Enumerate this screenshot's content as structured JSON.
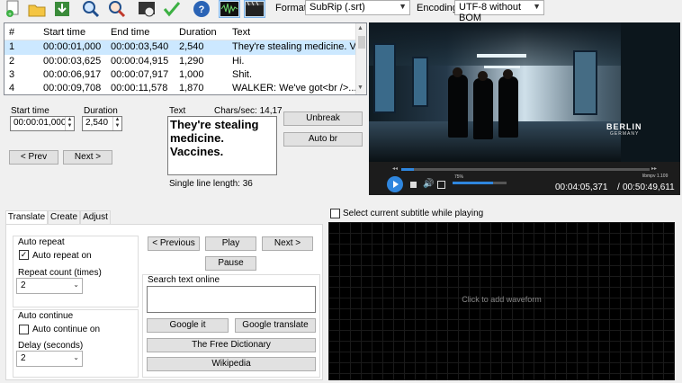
{
  "toolbar": {
    "icons": [
      "new-file-icon",
      "open-folder-icon",
      "save-icon",
      "find-icon",
      "replace-icon",
      "visual-sync-icon",
      "spell-check-icon",
      "help-icon",
      "waveform-toggle-icon",
      "video-toggle-icon"
    ],
    "format_label": "Format",
    "format_value": "SubRip (.srt)",
    "encoding_label": "Encoding",
    "encoding_value": "UTF-8 without BOM"
  },
  "grid": {
    "columns": [
      "#",
      "Start time",
      "End time",
      "Duration",
      "Text"
    ],
    "rows": [
      {
        "n": "1",
        "start": "00:00:01,000",
        "end": "00:00:03,540",
        "dur": "2,540",
        "text": "They're stealing medicine. Va"
      },
      {
        "n": "2",
        "start": "00:00:03,625",
        "end": "00:00:04,915",
        "dur": "1,290",
        "text": "Hi."
      },
      {
        "n": "3",
        "start": "00:00:06,917",
        "end": "00:00:07,917",
        "dur": "1,000",
        "text": "Shit."
      },
      {
        "n": "4",
        "start": "00:00:09,708",
        "end": "00:00:11,578",
        "dur": "1,870",
        "text": "WALKER: We've got<br />..."
      }
    ]
  },
  "edit": {
    "start_label": "Start time",
    "start_value": "00:00:01,000",
    "duration_label": "Duration",
    "duration_value": "2,540",
    "text_label": "Text",
    "chars_label": "Chars/sec: 14,17",
    "text_line1": "They're stealing",
    "text_line2": "medicine.",
    "text_line3": "Vaccines.",
    "single_line_length": "Single line length: 36",
    "unbreak": "Unbreak",
    "auto_br": "Auto br",
    "prev": "< Prev",
    "next": "Next >"
  },
  "video": {
    "sign_line1": "BERLIN",
    "sign_line2": "GERMANY",
    "progress": 0.05,
    "volume_percent": "75%",
    "volume": 0.75,
    "player_name": "libmpv 1.109",
    "time_current": "00:04:05,371",
    "time_total": "00:50:49,611"
  },
  "lower": {
    "tabs": [
      "Translate",
      "Create",
      "Adjust"
    ],
    "select_current_label": "Select current subtitle while playing",
    "auto_repeat_title": "Auto repeat",
    "auto_repeat_on": "Auto repeat on",
    "repeat_count_label": "Repeat count (times)",
    "repeat_count_value": "2",
    "auto_continue_title": "Auto continue",
    "auto_continue_on": "Auto continue on",
    "delay_label": "Delay (seconds)",
    "delay_value": "2",
    "previous": "< Previous",
    "play": "Play",
    "next": "Next >",
    "pause": "Pause",
    "search_label": "Search text online",
    "google_it": "Google it",
    "google_translate": "Google translate",
    "free_dictionary": "The Free Dictionary",
    "wikipedia": "Wikipedia",
    "waveform_hint": "Click to add waveform"
  }
}
